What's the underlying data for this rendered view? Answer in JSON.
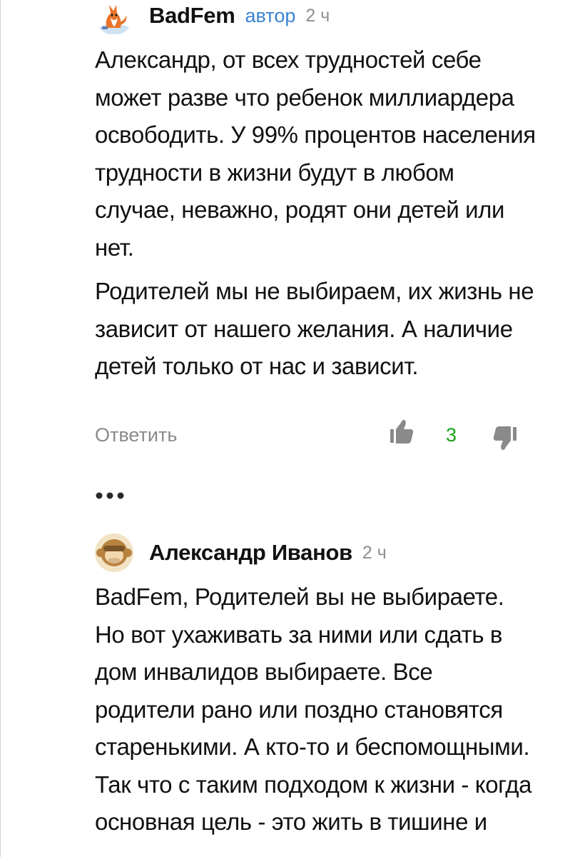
{
  "comments": [
    {
      "author": "BadFem",
      "badge": "автор",
      "time": "2 ч",
      "paragraphs": [
        "Александр, от всех трудностей себе может разве что ребенок миллиардера освободить. У 99% процентов населения трудности в жизни будут в любом случае, неважно, родят они детей или нет.",
        "Родителей мы не выбираем, их жизнь не зависит от нашего желания. А наличие детей только от нас и зависит."
      ],
      "reply_label": "Ответить",
      "likes": "3",
      "avatar_icon": "fox-icon"
    },
    {
      "author": "Александр Иванов",
      "time": "2 ч",
      "paragraphs": [
        "BadFem, Родителей вы не выбираете. Но вот ухаживать за ними или сдать в дом инвалидов выбираете. Все родители рано или поздно становятся старенькими. А кто-то и беспомощными. Так что с таким подходом к жизни - когда основная цель - это жить в тишине и"
      ],
      "avatar_icon": "monkey-icon"
    }
  ],
  "colors": {
    "badge": "#3b82d0",
    "likes": "#19a019",
    "muted": "#8a8a8a"
  },
  "icons": {
    "like": "thumbs-up-icon",
    "dislike": "thumbs-down-icon",
    "more": "more-dots-icon"
  }
}
